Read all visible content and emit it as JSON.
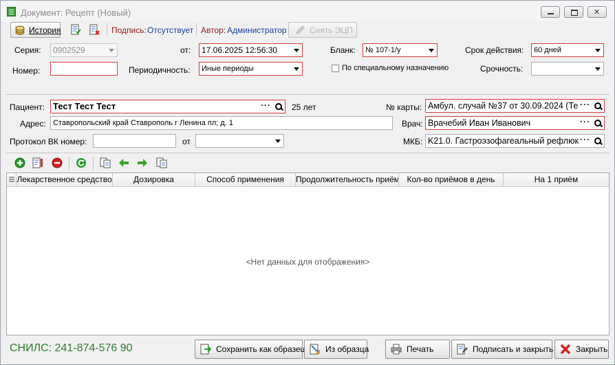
{
  "window": {
    "title": "Документ: Рецепт (Новый)"
  },
  "toolbar": {
    "history": "История",
    "sign_label": "Подпись:",
    "sign_value": "Отсутствует",
    "author_label": "Автор:",
    "author_value": "Администратор",
    "remove_sign": "Снять ЭЦП"
  },
  "form": {
    "series_label": "Серия:",
    "series_value": "0902529",
    "number_label": "Номер:",
    "number_value": "",
    "from_label": "от:",
    "from_value": "17.06.2025 12:56:30",
    "period_label": "Периодичность:",
    "period_value": "Иные периоды",
    "blank_label": "Бланк:",
    "blank_value": "№ 107-1/у",
    "special_label": "По специальному назначению",
    "validity_label": "Срок действия:",
    "validity_value": "60 дней",
    "urgency_label": "Срочность:",
    "urgency_value": ""
  },
  "patient": {
    "patient_label": "Пациент:",
    "patient_value": "Тест Тест Тест",
    "age": "25 лет",
    "address_label": "Адрес:",
    "address_value": "Ставропольский край Ставрополь г Ленина пл; д. 1",
    "protocol_label": "Протокол ВК номер:",
    "protocol_value": "",
    "protocol_from_label": "от",
    "protocol_from_value": "",
    "card_label": "№ карты:",
    "card_value": "Амбул. случай №37 от 30.09.2024 (Те",
    "doctor_label": "Врач:",
    "doctor_value": "Врачебий Иван Иванович",
    "mkb_label": "МКБ:",
    "mkb_value": "K21.0. Гастроэзофагеальный рефлюкс"
  },
  "grid": {
    "columns": [
      "Лекарственное средство",
      "Дозировка",
      "Способ применения",
      "Продолжительность приёма",
      "Кол-во приёмов в день",
      "На 1 приём"
    ],
    "empty": "<Нет данных для отображения>"
  },
  "footer": {
    "snils": "СНИЛС: 241-874-576 90",
    "save_template": "Сохранить как образец",
    "from_template": "Из образца",
    "print": "Печать",
    "sign_close": "Подписать и закрыть",
    "close": "Закрыть"
  },
  "colors": {
    "required": "#d53a3a",
    "snils": "#2f7d2f",
    "sign_value": "#1a3f9a",
    "author_label": "#8b1a1a"
  }
}
